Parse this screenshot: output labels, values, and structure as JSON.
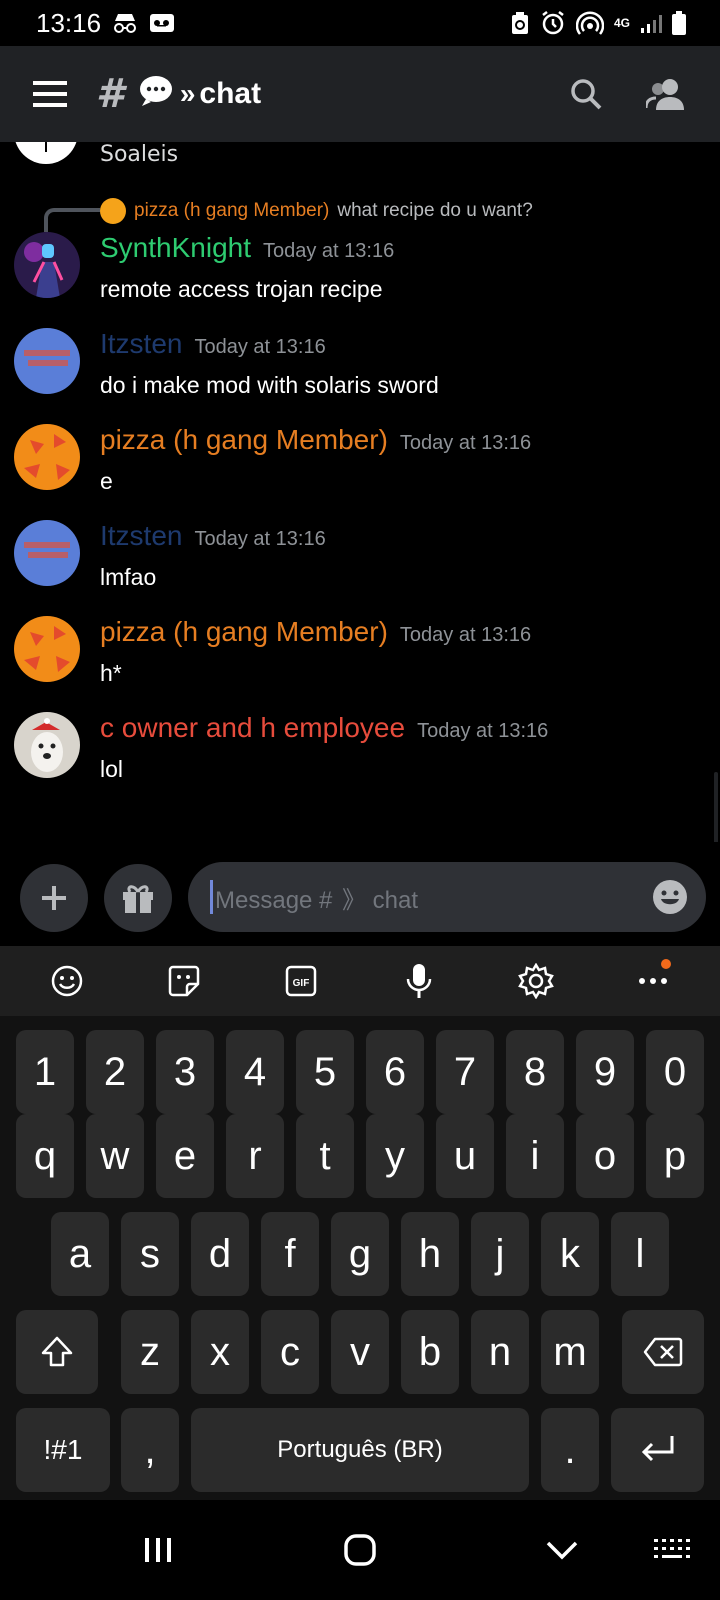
{
  "status": {
    "time": "13:16",
    "network": "4G"
  },
  "header": {
    "channel_title": "chat",
    "search_label": "search",
    "members_label": "members"
  },
  "chat": {
    "previous_message_text": "Soaleis",
    "reply": {
      "author": "pizza (h gang Member)",
      "text": "what recipe do u want?"
    },
    "messages": [
      {
        "author": "SynthKnight",
        "author_color": "#2ecc71",
        "time": "Today at 13:16",
        "text": "remote access trojan recipe"
      },
      {
        "author": "Itzsten",
        "author_color": "#1e3a6e",
        "time": "Today at 13:16",
        "text": "do i make mod with solaris sword"
      },
      {
        "author": "pizza (h gang Member)",
        "author_color": "#e67e22",
        "time": "Today at 13:16",
        "text": "e"
      },
      {
        "author": "Itzsten",
        "author_color": "#1e3a6e",
        "time": "Today at 13:16",
        "text": "lmfao"
      },
      {
        "author": "pizza (h gang Member)",
        "author_color": "#e67e22",
        "time": "Today at 13:16",
        "text": "h*"
      },
      {
        "author": "c owner and h employee",
        "author_color": "#e74c3c",
        "time": "Today at 13:16",
        "text": "lol"
      }
    ]
  },
  "composer": {
    "placeholder": "Message #  》 chat"
  },
  "keyboard": {
    "number_row": [
      "1",
      "2",
      "3",
      "4",
      "5",
      "6",
      "7",
      "8",
      "9",
      "0"
    ],
    "row1": [
      "q",
      "w",
      "e",
      "r",
      "t",
      "y",
      "u",
      "i",
      "o",
      "p"
    ],
    "row2": [
      "a",
      "s",
      "d",
      "f",
      "g",
      "h",
      "j",
      "k",
      "l"
    ],
    "row3": [
      "z",
      "x",
      "c",
      "v",
      "b",
      "n",
      "m"
    ],
    "symbols_label": "!#1",
    "comma_label": ",",
    "space_label": "Português (BR)",
    "period_label": "."
  },
  "colors": {
    "accent": "#7289da",
    "background": "#000000",
    "header_bg": "#202225"
  }
}
